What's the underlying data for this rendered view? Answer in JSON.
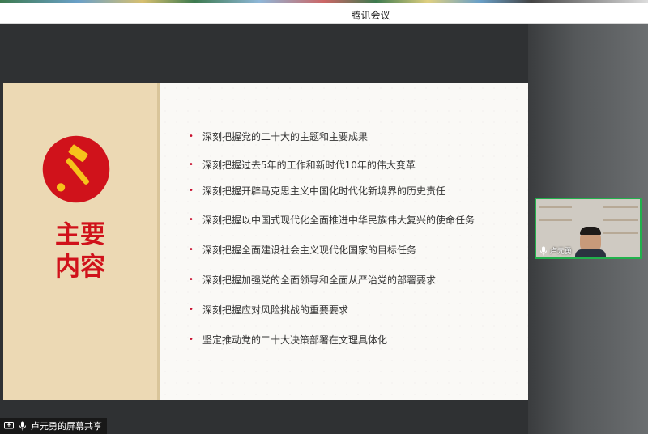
{
  "window": {
    "title": "腾讯会议"
  },
  "slide": {
    "title_line1": "主要",
    "title_line2": "内容",
    "bullets": [
      "深刻把握党的二十大的主题和主要成果",
      "深刻把握过去5年的工作和新时代10年的伟大变革",
      "深刻把握开辟马克思主义中国化时代化新境界的历史责任",
      "深刻把握以中国式现代化全面推进中华民族伟大复兴的使命任务",
      "深刻把握全面建设社会主义现代化国家的目标任务",
      "深刻把握加强党的全面领导和全面从严治党的部署要求",
      "深刻把握应对风险挑战的重要要求",
      "坚定推动党的二十大决策部署在文理具体化"
    ]
  },
  "participant": {
    "name": "卢元勇",
    "mic_icon": "microphone-icon"
  },
  "share_status": {
    "label": "卢元勇的屏幕共享",
    "icon": "screen-share-icon"
  },
  "colors": {
    "party_red": "#d0121b",
    "emblem_gold": "#f6c21b",
    "active_border": "#22b14c"
  }
}
